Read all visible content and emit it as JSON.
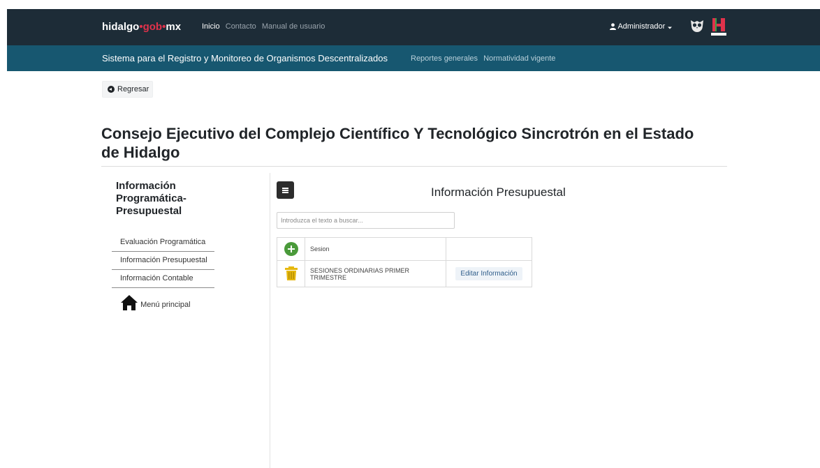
{
  "header": {
    "brand_part1": "hidalgo",
    "brand_dot": "•",
    "brand_part2": "gob",
    "brand_part3": "mx",
    "nav": [
      "Inicio",
      "Contacto",
      "Manual de usuario"
    ],
    "user_label": "Administrador",
    "logo1_icon": "owl-emblem-icon",
    "logo2_icon": "hidalgo-logo-icon"
  },
  "subheader": {
    "title": "Sistema para el Registro y Monitoreo de Organismos Descentralizados",
    "links": [
      "Reportes generales",
      "Normatividad vigente"
    ]
  },
  "back_label": "Regresar",
  "page_title": "Consejo Ejecutivo del Complejo Científico Y Tecnológico Sincrotrón en el Estado de Hidalgo",
  "sidebar": {
    "title": "Información Programática-Presupuestal",
    "items": [
      {
        "label": "Evaluación Programática"
      },
      {
        "label": "Información Presupuestal"
      },
      {
        "label": "Información Contable"
      }
    ],
    "home_label": "Menú principal"
  },
  "main": {
    "title": "Información Presupuestal",
    "search_placeholder": "Introduzca el texto a buscar...",
    "table": {
      "header_col": "Sesion",
      "rows": [
        {
          "session": "SESIONES ORDINARIAS PRIMER TRIMESTRE",
          "action": "Editar Información"
        }
      ]
    }
  },
  "colors": {
    "topbar": "#1d2c37",
    "subbar": "#175770",
    "brand_accent": "#e0324b",
    "add_green": "#4a9a3a",
    "trash_gold": "#e6b80e"
  }
}
